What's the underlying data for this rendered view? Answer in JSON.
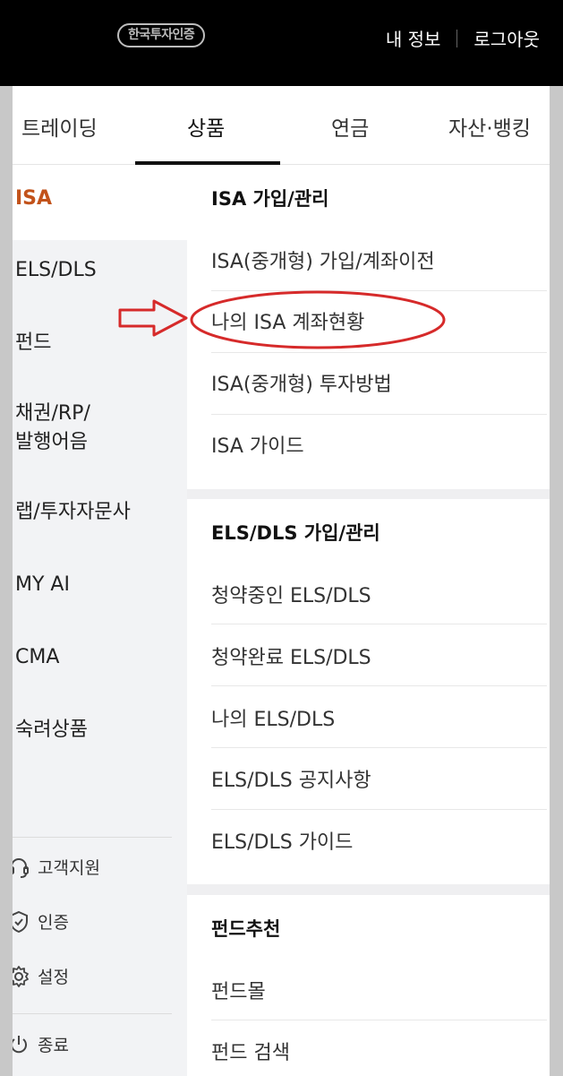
{
  "header": {
    "logo": "한국투자인증",
    "my_info": "내 정보",
    "logout": "로그아웃"
  },
  "tabs": [
    {
      "label": "트레이딩"
    },
    {
      "label": "상품"
    },
    {
      "label": "연금"
    },
    {
      "label": "자산·뱅킹"
    }
  ],
  "sidebar": {
    "items": [
      {
        "label": "ISA"
      },
      {
        "label": "ELS/DLS"
      },
      {
        "label": "펀드"
      },
      {
        "label": "채권/RP/"
      },
      {
        "label": "발행어음"
      },
      {
        "label": "랩/투자자문사"
      },
      {
        "label": "MY AI"
      },
      {
        "label": "CMA"
      },
      {
        "label": "숙려상품"
      }
    ],
    "utils": [
      {
        "label": "고객지원",
        "icon": "headset-icon"
      },
      {
        "label": "인증",
        "icon": "shield-check-icon"
      },
      {
        "label": "설정",
        "icon": "gear-icon"
      },
      {
        "label": "종료",
        "icon": "power-icon"
      }
    ]
  },
  "sections": [
    {
      "title": "ISA 가입/관리",
      "items": [
        "ISA(중개형) 가입/계좌이전",
        "나의 ISA 계좌현황",
        "ISA(중개형) 투자방법",
        "ISA 가이드"
      ]
    },
    {
      "title": "ELS/DLS 가입/관리",
      "items": [
        "청약중인 ELS/DLS",
        "청약완료 ELS/DLS",
        "나의 ELS/DLS",
        "ELS/DLS 공지사항",
        "ELS/DLS 가이드"
      ]
    },
    {
      "title": "펀드추천",
      "items": [
        "펀드몰",
        "펀드 검색"
      ]
    }
  ],
  "colors": {
    "accent": "#c2521a",
    "annotation_red": "#d62a2a"
  }
}
